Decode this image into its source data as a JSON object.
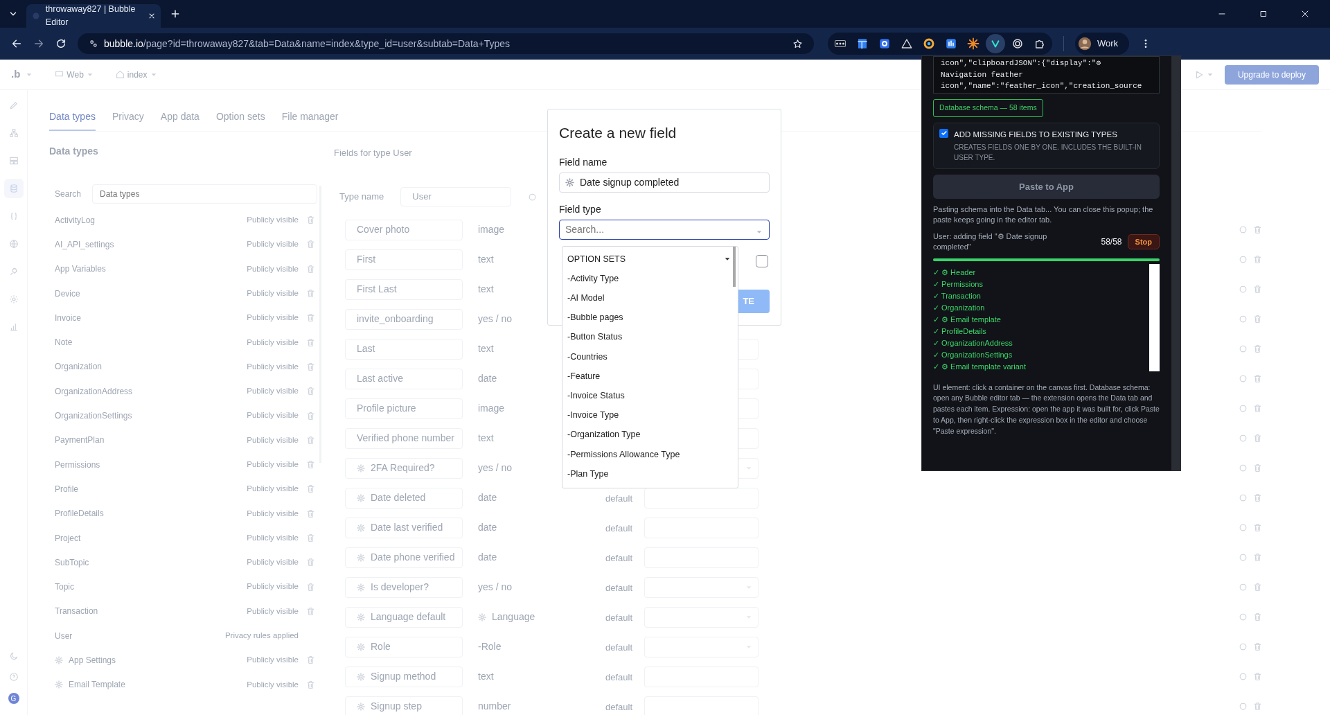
{
  "browser": {
    "tab_title": "throwaway827 | Bubble Editor",
    "url_host": "bubble.io",
    "url_path": "/page?id=throwaway827&tab=Data&name=index&type_id=user&subtab=Data+Types",
    "profile": "Work"
  },
  "editor": {
    "top_bar": {
      "logo": ".b",
      "platform": "Web",
      "page": "index",
      "deploy_button": "Upgrade to deploy"
    },
    "rail": [
      {
        "kind": "pencil",
        "selected": false
      },
      {
        "kind": "sitemap",
        "selected": false
      },
      {
        "kind": "layout",
        "selected": false
      },
      {
        "kind": "database",
        "selected": true
      },
      {
        "kind": "braces",
        "selected": false
      },
      {
        "kind": "globe",
        "selected": false
      },
      {
        "kind": "plug",
        "selected": false
      },
      {
        "kind": "gear",
        "selected": false
      },
      {
        "kind": "chart",
        "selected": false
      }
    ],
    "rail_bottom": {
      "avatar": "G"
    },
    "tabs": [
      {
        "label": "Data types",
        "selected": true
      },
      {
        "label": "Privacy",
        "selected": false
      },
      {
        "label": "App data",
        "selected": false
      },
      {
        "label": "Option sets",
        "selected": false
      },
      {
        "label": "File manager",
        "selected": false
      }
    ],
    "types_panel": {
      "title": "Data types",
      "search_label": "Search",
      "search_placeholder": "Data types",
      "items": [
        {
          "name": "ActivityLog",
          "visibility": "Publicly visible",
          "gear": false,
          "deletable": true
        },
        {
          "name": "AI_API_settings",
          "visibility": "Publicly visible",
          "gear": false,
          "deletable": true
        },
        {
          "name": "App Variables",
          "visibility": "Publicly visible",
          "gear": false,
          "deletable": true
        },
        {
          "name": "Device",
          "visibility": "Publicly visible",
          "gear": false,
          "deletable": true
        },
        {
          "name": "Invoice",
          "visibility": "Publicly visible",
          "gear": false,
          "deletable": true
        },
        {
          "name": "Note",
          "visibility": "Publicly visible",
          "gear": false,
          "deletable": true
        },
        {
          "name": "Organization",
          "visibility": "Publicly visible",
          "gear": false,
          "deletable": true
        },
        {
          "name": "OrganizationAddress",
          "visibility": "Publicly visible",
          "gear": false,
          "deletable": true
        },
        {
          "name": "OrganizationSettings",
          "visibility": "Publicly visible",
          "gear": false,
          "deletable": true
        },
        {
          "name": "PaymentPlan",
          "visibility": "Publicly visible",
          "gear": false,
          "deletable": true
        },
        {
          "name": "Permissions",
          "visibility": "Publicly visible",
          "gear": false,
          "deletable": true
        },
        {
          "name": "Profile",
          "visibility": "Publicly visible",
          "gear": false,
          "deletable": true
        },
        {
          "name": "ProfileDetails",
          "visibility": "Publicly visible",
          "gear": false,
          "deletable": true
        },
        {
          "name": "Project",
          "visibility": "Publicly visible",
          "gear": false,
          "deletable": true
        },
        {
          "name": "SubTopic",
          "visibility": "Publicly visible",
          "gear": false,
          "deletable": true
        },
        {
          "name": "Topic",
          "visibility": "Publicly visible",
          "gear": false,
          "deletable": true
        },
        {
          "name": "Transaction",
          "visibility": "Publicly visible",
          "gear": false,
          "deletable": true
        },
        {
          "name": "User",
          "visibility": "Privacy rules applied",
          "gear": false,
          "deletable": false
        },
        {
          "name": "App Settings",
          "visibility": "Publicly visible",
          "gear": true,
          "deletable": true
        },
        {
          "name": "Email Template",
          "visibility": "Publicly visible",
          "gear": true,
          "deletable": true
        }
      ]
    },
    "fields_panel": {
      "title": "Fields for type User",
      "type_name_label": "Type name",
      "type_name_value": "User",
      "fields": [
        {
          "name": "Cover photo",
          "type": "image",
          "gear": false,
          "type_gear": false
        },
        {
          "name": "First",
          "type": "text",
          "gear": false,
          "type_gear": false
        },
        {
          "name": "First Last",
          "type": "text",
          "gear": false,
          "type_gear": false
        },
        {
          "name": "invite_onboarding",
          "type": "yes / no",
          "gear": false,
          "type_gear": false
        },
        {
          "name": "Last",
          "type": "text",
          "gear": false,
          "type_gear": false,
          "dropdown": false
        },
        {
          "name": "Last active",
          "type": "date",
          "gear": false,
          "type_gear": false,
          "dropdown": false
        },
        {
          "name": "Profile picture",
          "type": "image",
          "gear": false,
          "type_gear": false,
          "dropdown": false
        },
        {
          "name": "Verified phone number",
          "type": "text",
          "gear": false,
          "type_gear": false,
          "dropdown": false
        },
        {
          "name": "2FA Required?",
          "type": "yes / no",
          "gear": true,
          "type_gear": false,
          "dropdown": true
        },
        {
          "name": "Date deleted",
          "type": "date",
          "gear": true,
          "type_gear": false,
          "dropdown": false,
          "default_label": "default"
        },
        {
          "name": "Date last verified",
          "type": "date",
          "gear": true,
          "type_gear": false,
          "dropdown": false,
          "default_label": "default"
        },
        {
          "name": "Date phone verified",
          "type": "date",
          "gear": true,
          "type_gear": false,
          "dropdown": false,
          "default_label": "default"
        },
        {
          "name": "Is developer?",
          "type": "yes / no",
          "gear": true,
          "type_gear": false,
          "dropdown": true,
          "default_label": "default"
        },
        {
          "name": "Language default",
          "type": "Language",
          "gear": true,
          "type_gear": true,
          "dropdown": true,
          "default_label": "default"
        },
        {
          "name": "Role",
          "type": "-Role",
          "gear": true,
          "type_gear": false,
          "dropdown": true,
          "default_label": "default"
        },
        {
          "name": "Signup method",
          "type": "text",
          "gear": true,
          "type_gear": false,
          "dropdown": false,
          "default_label": "default"
        },
        {
          "name": "Signup step",
          "type": "number",
          "gear": true,
          "type_gear": false,
          "dropdown": false,
          "default_label": "default"
        }
      ]
    }
  },
  "modal": {
    "title": "Create a new field",
    "field_name_label": "Field name",
    "field_name_value": "Date signup completed",
    "field_name_gear": true,
    "field_type_label": "Field type",
    "field_type_placeholder": "Search...",
    "checkbox_checked": false,
    "create_button": "TE"
  },
  "dropdown": {
    "header": "OPTION SETS",
    "items": [
      "-Activity Type",
      "-AI Model",
      "-Bubble pages",
      "-Button Status",
      "-Countries",
      "-Feature",
      "-Invoice Status",
      "-Invoice Type",
      "-Organization Type",
      "-Permissions Allowance Type",
      "-Plan Type"
    ]
  },
  "extension": {
    "textarea_lines": [
      "icon\",\"clipboardJSON\":{\"display\":\"⚙",
      "Navigation feather",
      "icon\",\"name\":\"feather_icon\",\"creation_source"
    ],
    "badge": "Database schema — 58 items",
    "option": {
      "title": "ADD MISSING FIELDS TO EXISTING TYPES",
      "description": "CREATES FIELDS ONE BY ONE. INCLUDES THE BUILT-IN USER TYPE.",
      "checked": true
    },
    "paste_button": {
      "label": "Paste to App",
      "disabled": true
    },
    "status": "Pasting schema into the Data tab... You can close this popup; the paste keeps going in the editor tab.",
    "progress": {
      "text": "User: adding field \"⚙ Date signup completed\"",
      "count": "58/58",
      "stop": "Stop",
      "level": 1
    },
    "log": [
      "✓ ⚙ Header",
      "✓ Permissions",
      "✓ Transaction",
      "✓ Organization",
      "✓ ⚙ Email template",
      "✓ ProfileDetails",
      "✓ OrganizationAddress",
      "✓ OrganizationSettings",
      "✓ ⚙ Email template variant"
    ],
    "help": "UI element: click a container on the canvas first. Database schema: open any Bubble editor tab — the extension opens the Data tab and pastes each item. Expression: open the app it was built for, click Paste to App, then right-click the expression box in the editor and choose \"Paste expression\"."
  }
}
